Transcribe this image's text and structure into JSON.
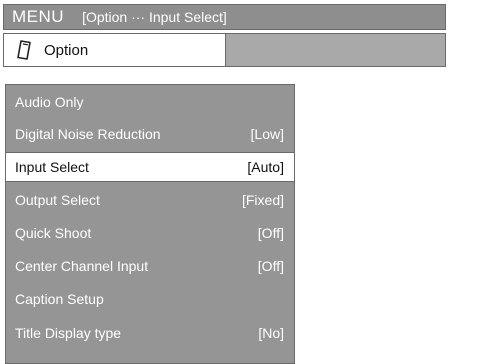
{
  "header": {
    "menu_label": "MENU",
    "context_label": "[Option ··· Input Select]"
  },
  "option_bar": {
    "icon": "remote-control-icon",
    "label": "Option"
  },
  "colors": {
    "title_bg": "#8e8e8e",
    "panel_bg": "#959595",
    "selected_bg": "#ffffff",
    "filler_bg": "#a9a9a9"
  },
  "menu": {
    "items": [
      {
        "label": "Audio Only",
        "value": ""
      },
      {
        "label": "Digital Noise Reduction",
        "value": "[Low]"
      },
      {
        "label": "Input Select",
        "value": "[Auto]",
        "selected": true
      },
      {
        "label": "Output Select",
        "value": "[Fixed]"
      },
      {
        "label": "Quick Shoot",
        "value": "[Off]"
      },
      {
        "label": "Center Channel Input",
        "value": "[Off]"
      },
      {
        "label": "Caption Setup",
        "value": ""
      },
      {
        "label": "Title Display type",
        "value": "[No]"
      }
    ]
  }
}
